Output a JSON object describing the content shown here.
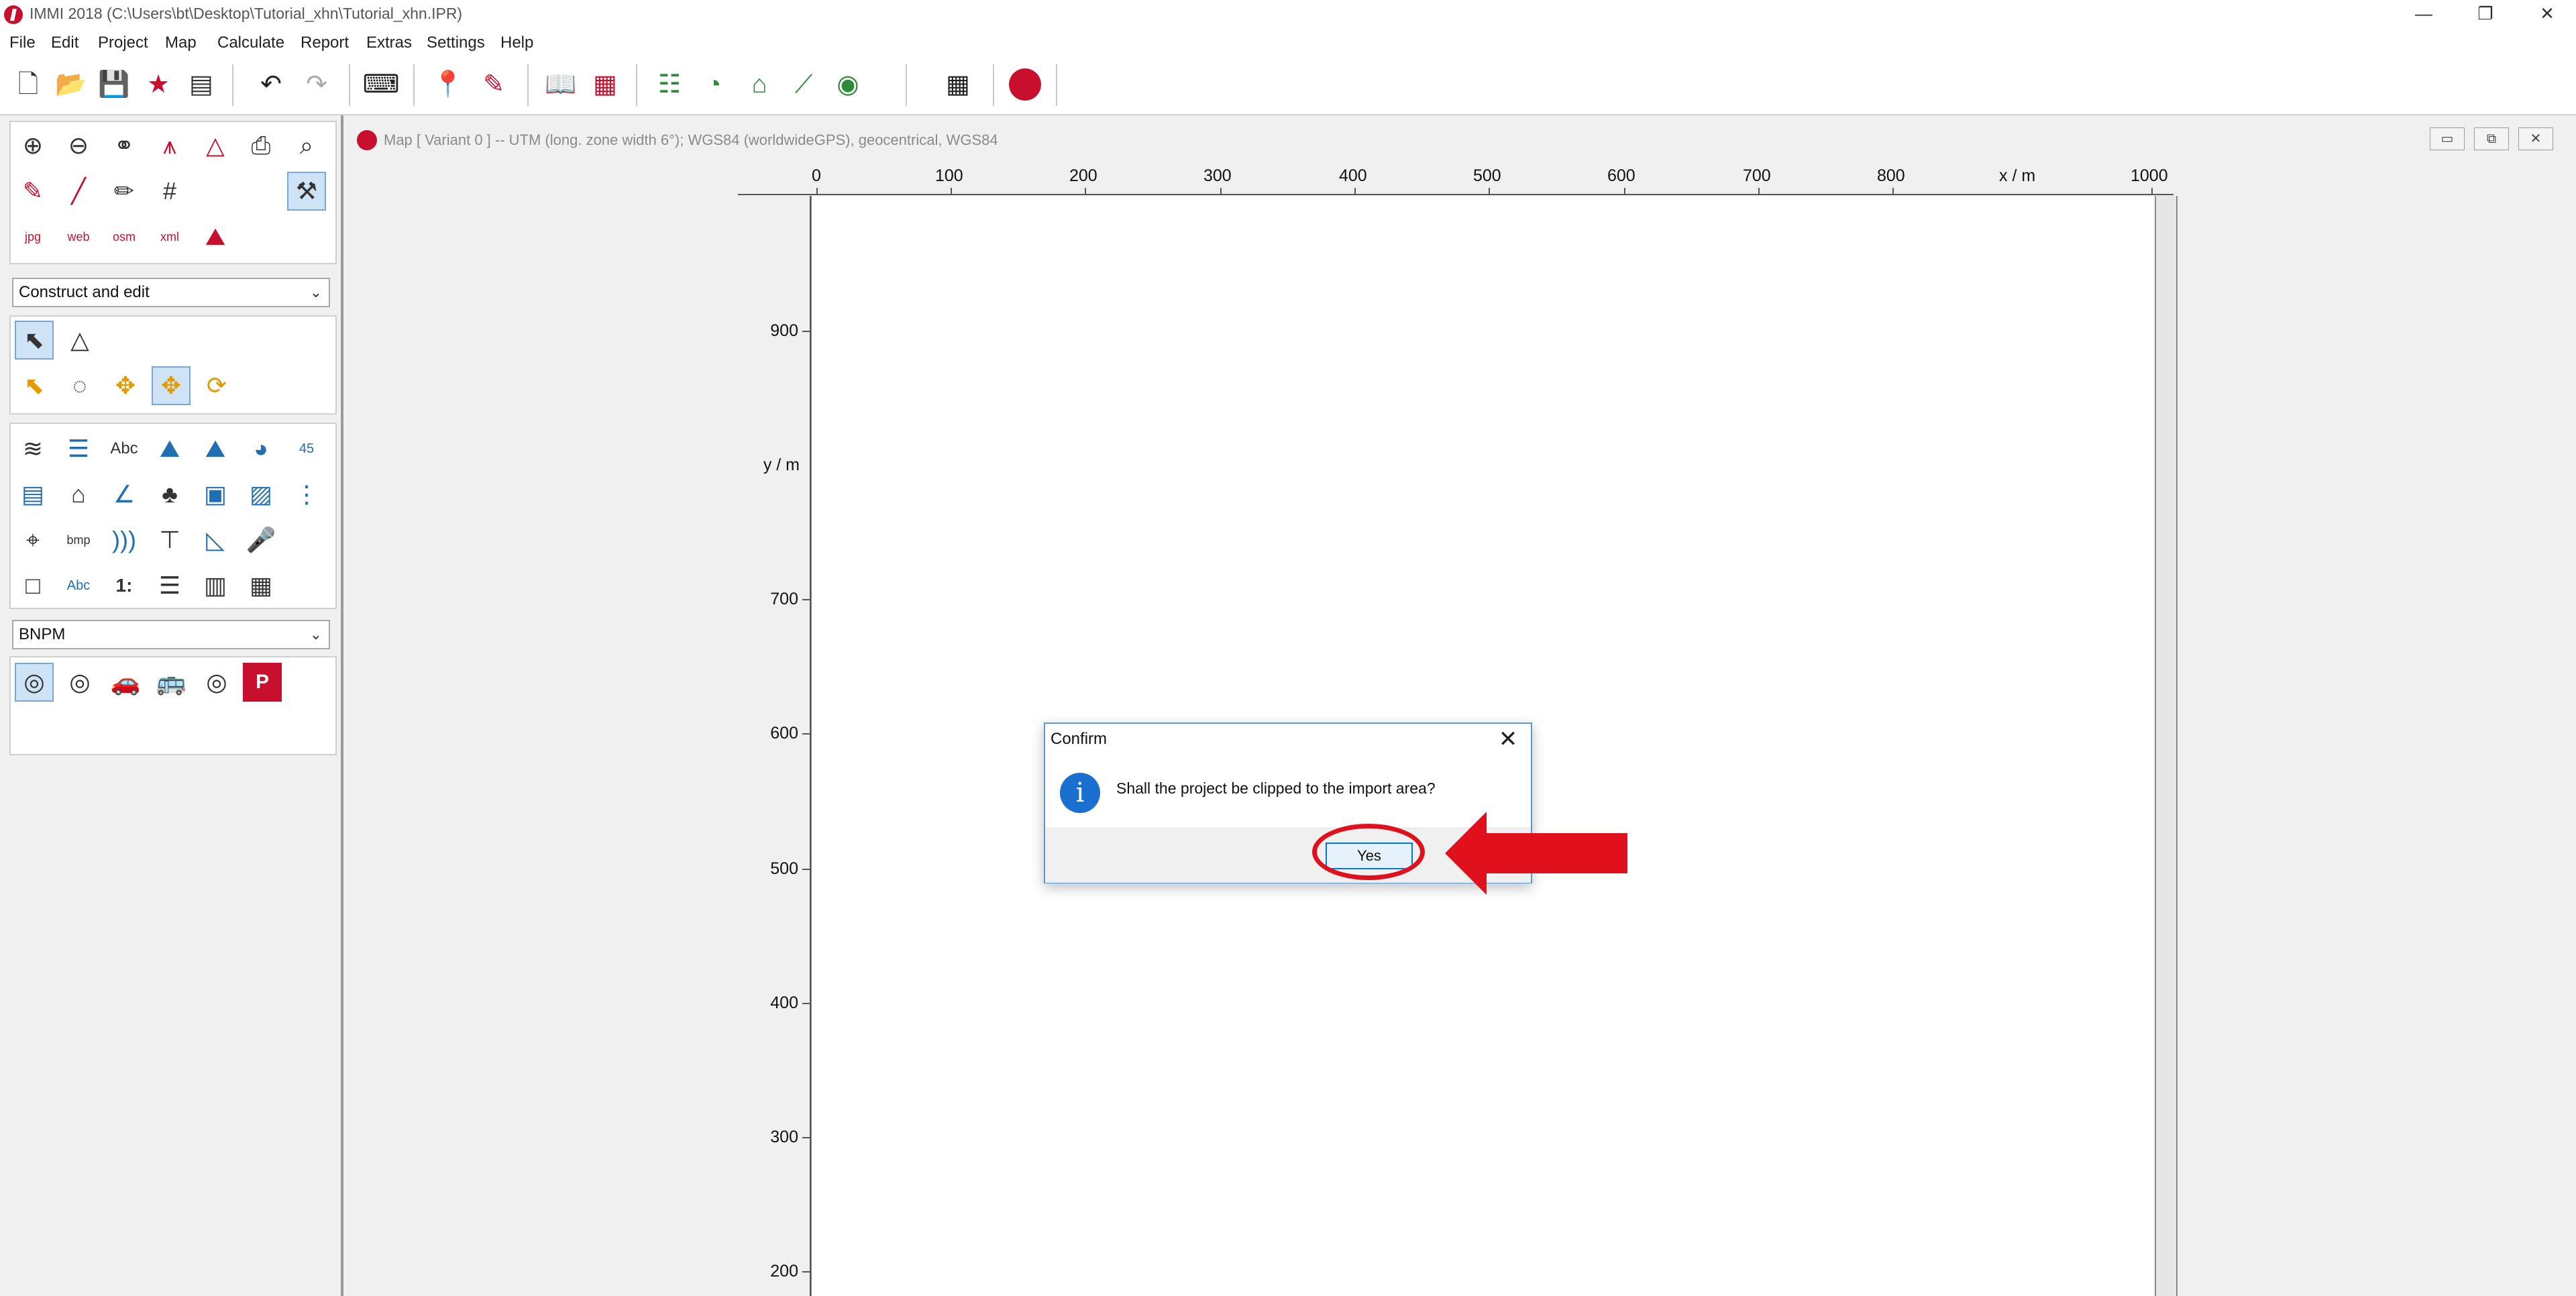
{
  "window": {
    "title": "IMMI 2018 (C:\\Users\\bt\\Desktop\\Tutorial_xhn\\Tutorial_xhn.IPR)",
    "minimize": "—",
    "restore": "❐",
    "close": "✕"
  },
  "menu": [
    "File",
    "Edit",
    "Project",
    "Map",
    "Calculate",
    "Report",
    "Extras",
    "Settings",
    "Help"
  ],
  "toolbar": {
    "icons": [
      "new-project-icon",
      "open-project-icon",
      "save-project-icon",
      "favorite-icon",
      "document-icon",
      "undo-icon",
      "redo-icon",
      "keyboard-icon",
      "locate-icon",
      "locate-edit-icon",
      "book-icon",
      "grid-list-icon",
      "settings-sliders-icon",
      "pie-icon",
      "house-icon",
      "graph-icon",
      "target-icon",
      "calculator-icon",
      "immi-logo-icon"
    ]
  },
  "left_panel": {
    "mode_select": "Construct and edit",
    "category_select": "BNPM",
    "small_labels": {
      "jpg": "jpg",
      "web": "web",
      "osm": "osm",
      "xml": "xml",
      "abc": "Abc",
      "bmp": "bmp",
      "one": "1:",
      "badge45": "45",
      "abc2": "Abc",
      "parking": "P"
    }
  },
  "map_window": {
    "title": "Map  [ Variant 0 ]  --  UTM (long. zone width 6°); WGS84 (worldwideGPS), geocentrical, WGS84",
    "x_ticks": [
      "0",
      "100",
      "200",
      "300",
      "400",
      "500",
      "600",
      "700",
      "800",
      "1000"
    ],
    "x_unit": "x / m",
    "y_ticks": [
      "900",
      "700",
      "600",
      "500",
      "400",
      "300",
      "200"
    ],
    "y_unit": "y / m",
    "mdi_minimize": "▭",
    "mdi_restore": "⧉",
    "mdi_close": "✕"
  },
  "dialog": {
    "title": "Confirm",
    "close": "✕",
    "info_glyph": "i",
    "message": "Shall the project be clipped to the import area?",
    "yes_label": "Yes"
  },
  "colors": {
    "accent_red": "#e0101c",
    "brand": "#c8102e",
    "info_blue": "#1b6fd0"
  }
}
